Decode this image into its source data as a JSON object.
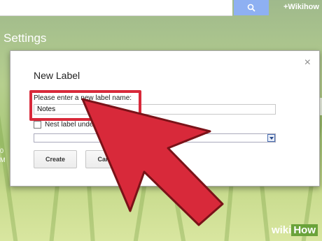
{
  "header": {
    "user_link": "+Wikihow"
  },
  "page": {
    "title": "Settings",
    "left_fragment": [
      "0",
      "M"
    ]
  },
  "dialog": {
    "title": "New Label",
    "close_glyph": "×",
    "prompt": "Please enter a new label name:",
    "label_name_value": "Notes",
    "nest_label_text": "Nest label unde",
    "create_label": "Create",
    "cancel_label": "Cance"
  },
  "watermark": {
    "part1": "wiki",
    "part2": "How"
  },
  "colors": {
    "highlight": "#d8293a",
    "arrow": "#d8293a",
    "search_button": "#8eb0f2"
  },
  "icons": {
    "search": "search-icon",
    "close": "close-icon",
    "dropdown": "chevron-down-icon",
    "arrow": "pointer-arrow"
  }
}
